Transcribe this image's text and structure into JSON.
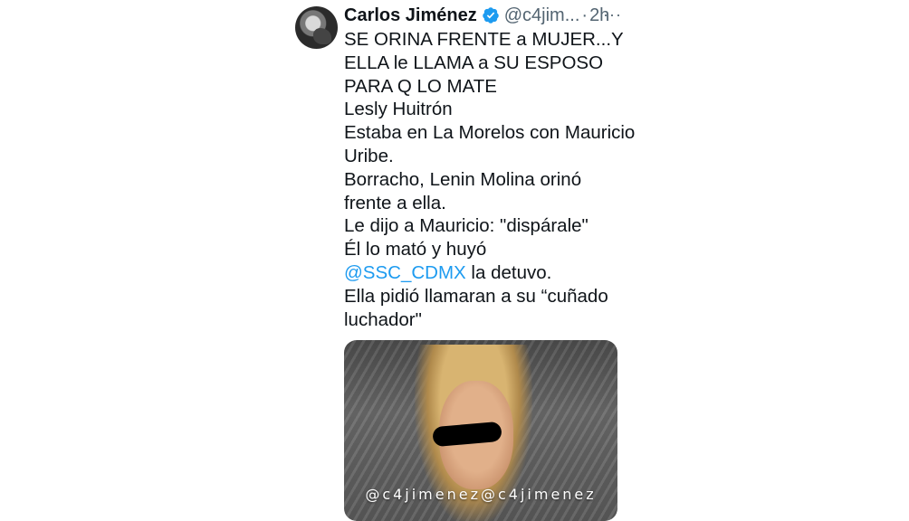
{
  "tweet": {
    "author_name": "Carlos Jiménez",
    "handle": "@c4jim...",
    "separator": "·",
    "time": "2h",
    "more": "···",
    "lines": [
      "SE ORINA FRENTE a MUJER...Y",
      "ELLA le LLAMA a SU ESPOSO",
      "PARA Q LO MATE",
      "Lesly Huitrón",
      "Estaba en La Morelos con Mauricio",
      "Uribe.",
      "Borracho, Lenin Molina orinó",
      "frente a ella.",
      "Le dijo a Mauricio: \"dispárale\"",
      "Él lo mató y huyó"
    ],
    "mention": "@SSC_CDMX",
    "mention_rest": " la detuvo.",
    "lines_after": [
      "Ella pidió llamaran a su “cuñado",
      "luchador\""
    ],
    "media_watermark": "@c4jimenez@c4jimenez"
  },
  "colors": {
    "text": "#0f1419",
    "secondary": "#536471",
    "link": "#1d9bf0",
    "verified": "#1d9bf0"
  }
}
